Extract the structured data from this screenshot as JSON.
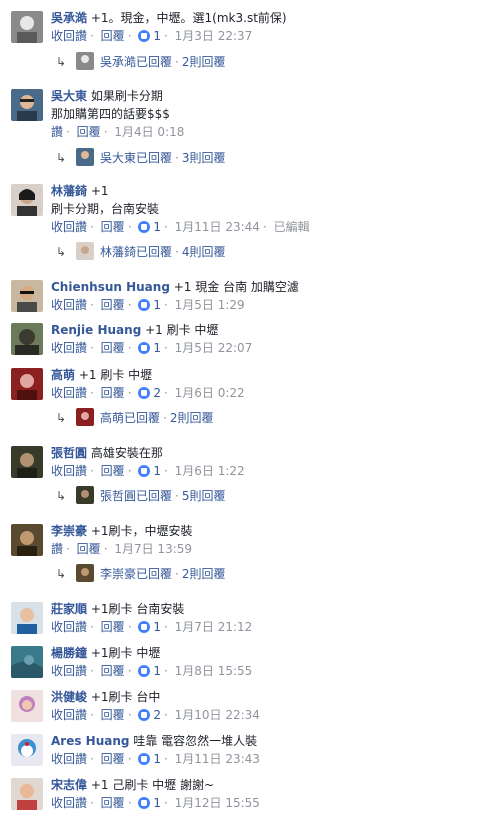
{
  "actions": {
    "retract_like": "收回讚",
    "like": "讚",
    "reply": "回覆",
    "edited": "已編輯"
  },
  "colors": {
    "link": "#365899",
    "meta": "#90949c",
    "like_badge": "#4080ff"
  },
  "comments": [
    {
      "name": "吳承澔",
      "text": "+1。現金，中壢。選1(mk3.st前保)",
      "like_label": "收回讚",
      "likes": "1",
      "time": "1月3日 22:37",
      "reply_author": "吳承澔已回覆",
      "reply_count": "2則回覆"
    },
    {
      "name": "吳大東",
      "text": "如果刷卡分期",
      "text2": "那加購第四的話要$$$",
      "like_label": "讚",
      "likes": "",
      "time": "1月4日 0:18",
      "reply_author": "吳大東已回覆",
      "reply_count": "3則回覆"
    },
    {
      "name": "林藩錡",
      "text": "+1",
      "text2": "刷卡分期，台南安裝",
      "like_label": "收回讚",
      "likes": "1",
      "time": "1月11日 23:44",
      "edited": "已編輯",
      "reply_author": "林藩錡已回覆",
      "reply_count": "4則回覆"
    },
    {
      "name": "Chienhsun Huang",
      "text": "+1 現金 台南 加購空濾",
      "like_label": "收回讚",
      "likes": "1",
      "time": "1月5日 1:29"
    },
    {
      "name": "Renjie Huang",
      "text": "+1 刷卡 中壢",
      "like_label": "收回讚",
      "likes": "1",
      "time": "1月5日 22:07"
    },
    {
      "name": "高萌",
      "text": "+1 刷卡 中壢",
      "like_label": "收回讚",
      "likes": "2",
      "time": "1月6日 0:22",
      "reply_author": "高萌已回覆",
      "reply_count": "2則回覆"
    },
    {
      "name": "張哲圓",
      "text": "高雄安裝在那",
      "like_label": "收回讚",
      "likes": "1",
      "time": "1月6日 1:22",
      "reply_author": "張哲圓已回覆",
      "reply_count": "5則回覆"
    },
    {
      "name": "李崇豪",
      "text": "+1刷卡，中壢安裝",
      "like_label": "讚",
      "likes": "",
      "time": "1月7日 13:59",
      "reply_author": "李崇豪已回覆",
      "reply_count": "2則回覆"
    },
    {
      "name": "莊家順",
      "text": "+1刷卡 台南安裝",
      "like_label": "收回讚",
      "likes": "1",
      "time": "1月7日 21:12"
    },
    {
      "name": "楊勝鐘",
      "text": "+1刷卡 中壢",
      "like_label": "收回讚",
      "likes": "1",
      "time": "1月8日 15:55"
    },
    {
      "name": "洪健峻",
      "text": "+1刷卡 台中",
      "like_label": "收回讚",
      "likes": "2",
      "time": "1月10日 22:34"
    },
    {
      "name": "Ares Huang",
      "text": "哇靠 電容忽然一堆人裝",
      "like_label": "收回讚",
      "likes": "1",
      "time": "1月11日 23:43"
    },
    {
      "name": "宋志偉",
      "text": "+1 己刷卡 中壢 謝謝~",
      "like_label": "收回讚",
      "likes": "1",
      "time": "1月12日 15:55"
    }
  ]
}
